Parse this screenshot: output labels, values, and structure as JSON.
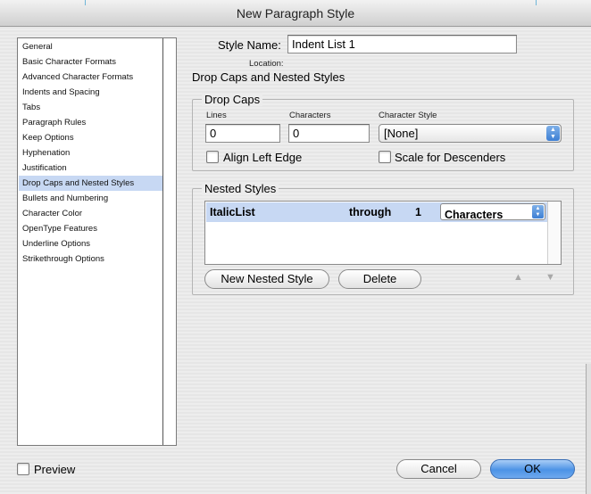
{
  "window": {
    "title": "New Paragraph Style"
  },
  "categories": [
    {
      "label": "General",
      "selected": false
    },
    {
      "label": "Basic Character Formats",
      "selected": false
    },
    {
      "label": "Advanced Character Formats",
      "selected": false
    },
    {
      "label": "Indents and Spacing",
      "selected": false
    },
    {
      "label": "Tabs",
      "selected": false
    },
    {
      "label": "Paragraph Rules",
      "selected": false
    },
    {
      "label": "Keep Options",
      "selected": false
    },
    {
      "label": "Hyphenation",
      "selected": false
    },
    {
      "label": "Justification",
      "selected": false
    },
    {
      "label": "Drop Caps and Nested Styles",
      "selected": true
    },
    {
      "label": "Bullets and Numbering",
      "selected": false
    },
    {
      "label": "Character Color",
      "selected": false
    },
    {
      "label": "OpenType Features",
      "selected": false
    },
    {
      "label": "Underline Options",
      "selected": false
    },
    {
      "label": "Strikethrough Options",
      "selected": false
    }
  ],
  "style_name": {
    "label": "Style Name:",
    "value": "Indent List 1"
  },
  "location": {
    "label": "Location:"
  },
  "section_heading": "Drop Caps and Nested Styles",
  "drop_caps": {
    "title": "Drop Caps",
    "lines_label": "Lines",
    "lines_value": "0",
    "characters_label": "Characters",
    "characters_value": "0",
    "char_style_label": "Character Style",
    "char_style_value": "[None]",
    "align_left_edge": {
      "label": "Align Left Edge",
      "checked": false
    },
    "scale_descenders": {
      "label": "Scale for Descenders",
      "checked": false
    }
  },
  "nested_styles": {
    "title": "Nested Styles",
    "rows": [
      {
        "style": "ItalicList",
        "through": "through",
        "count": "1",
        "unit": "Characters"
      }
    ],
    "new_button": "New Nested Style",
    "delete_button": "Delete",
    "up_glyph": "▲",
    "down_glyph": "▼"
  },
  "preview": {
    "label": "Preview",
    "checked": false
  },
  "buttons": {
    "cancel": "Cancel",
    "ok": "OK"
  },
  "colors": {
    "selection": "#c7d8f3",
    "accent_blue": "#4c93e6"
  }
}
